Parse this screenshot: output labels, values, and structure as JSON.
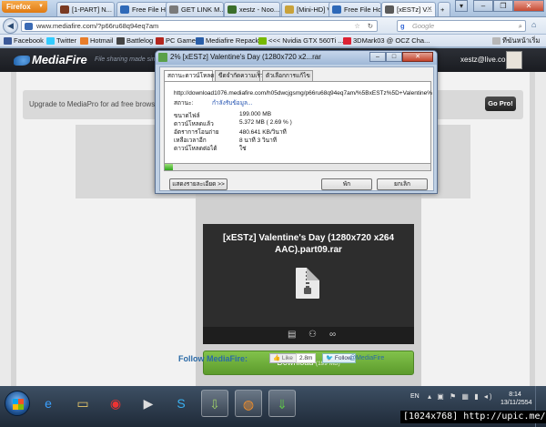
{
  "browser": {
    "menu_label": "Firefox",
    "tabs": [
      {
        "label": "[1-PART] N...",
        "color": "#7a3a22"
      },
      {
        "label": "Free File Ho...",
        "color": "#2e69b8"
      },
      {
        "label": "GET LINK M...",
        "color": "#7a7a7a"
      },
      {
        "label": "xestz - Noo...",
        "color": "#3b6e2a"
      },
      {
        "label": "[Mini-HD] V...",
        "color": "#c9a23a"
      },
      {
        "label": "Free File Ho...",
        "color": "#2e69b8"
      },
      {
        "label": "[xESTz] V...",
        "color": "#5a5a5a"
      }
    ],
    "url": "www.mediafire.com/?p66ru68q94eq7am",
    "search_placeholder": "Google",
    "bookmarks": [
      {
        "label": "Facebook",
        "color": "#3b5998"
      },
      {
        "label": "Twitter",
        "color": "#33ccff"
      },
      {
        "label": "Hotmail",
        "color": "#e87d2a"
      },
      {
        "label": "Battlelog",
        "color": "#444"
      },
      {
        "label": "PC Game",
        "color": "#b3261e"
      },
      {
        "label": "Mediafire Repack",
        "color": "#2a5ea8"
      },
      {
        "label": "<<< Nvidia GTX 560Ti ...",
        "color": "#76b900"
      },
      {
        "label": "3DMark03 @ OCZ Cha...",
        "color": "#d23"
      },
      {
        "label": "ทีฆันหน้าเริ่ม",
        "color": "#b7b7b7"
      }
    ]
  },
  "mediafire": {
    "logo": "MediaFire",
    "tagline": "File sharing made sim",
    "user": "xestz@live.com",
    "upgrade_text": "Upgrade to MediaPro for ad free browsi",
    "gopro_label": "Go Pro!",
    "filename": "[xESTz] Valentine's Day (1280x720 x264 AAC).part09.rar",
    "download_label": "Download",
    "download_size": "(199 MB)",
    "follow_label": "Follow MediaFire:",
    "like_label": "Like",
    "like_count": "2.8m",
    "twitter_label": "Follow",
    "twitter_handle": "@MediaFire"
  },
  "dialog": {
    "title": "2% [xESTz] Valentine's Day (1280x720 x2...rar",
    "tabs": [
      "สถานะดาวน์โหลด",
      "ขีดจำกัดความเร็ว",
      "ตัวเลือกการแก้ไข"
    ],
    "url": "http://download1076.mediafire.com/h05dwcjgsmg/p66ru68q94eq7am/%5BxESTz%5D+Valentine%",
    "status_label": "สถานะ:",
    "status_value": "กำลังรับข้อมูล...",
    "rows": [
      {
        "label": "ขนาดไฟล์",
        "value": "199.000  MB"
      },
      {
        "label": "ดาวน์โหลดแล้ว",
        "value": "5.372  MB  ( 2.69 % )"
      },
      {
        "label": "อัตราการโอนถ่าย",
        "value": "480.641  KB/วินาที"
      },
      {
        "label": "เหลือเวลาอีก",
        "value": "8 นาที 3 วินาที"
      },
      {
        "label": "ดาวน์โหลดต่อได้",
        "value": "ใช่"
      }
    ],
    "progress": 0.0269,
    "details_button": "แสดงรายละเอียด >>",
    "pause_button": "พัก",
    "cancel_button": "ยกเลิก"
  },
  "taskbar": {
    "language": "EN",
    "time": "8:14",
    "date": "13/11/2554"
  },
  "watermark": "[1024x768] http://upic.me/"
}
